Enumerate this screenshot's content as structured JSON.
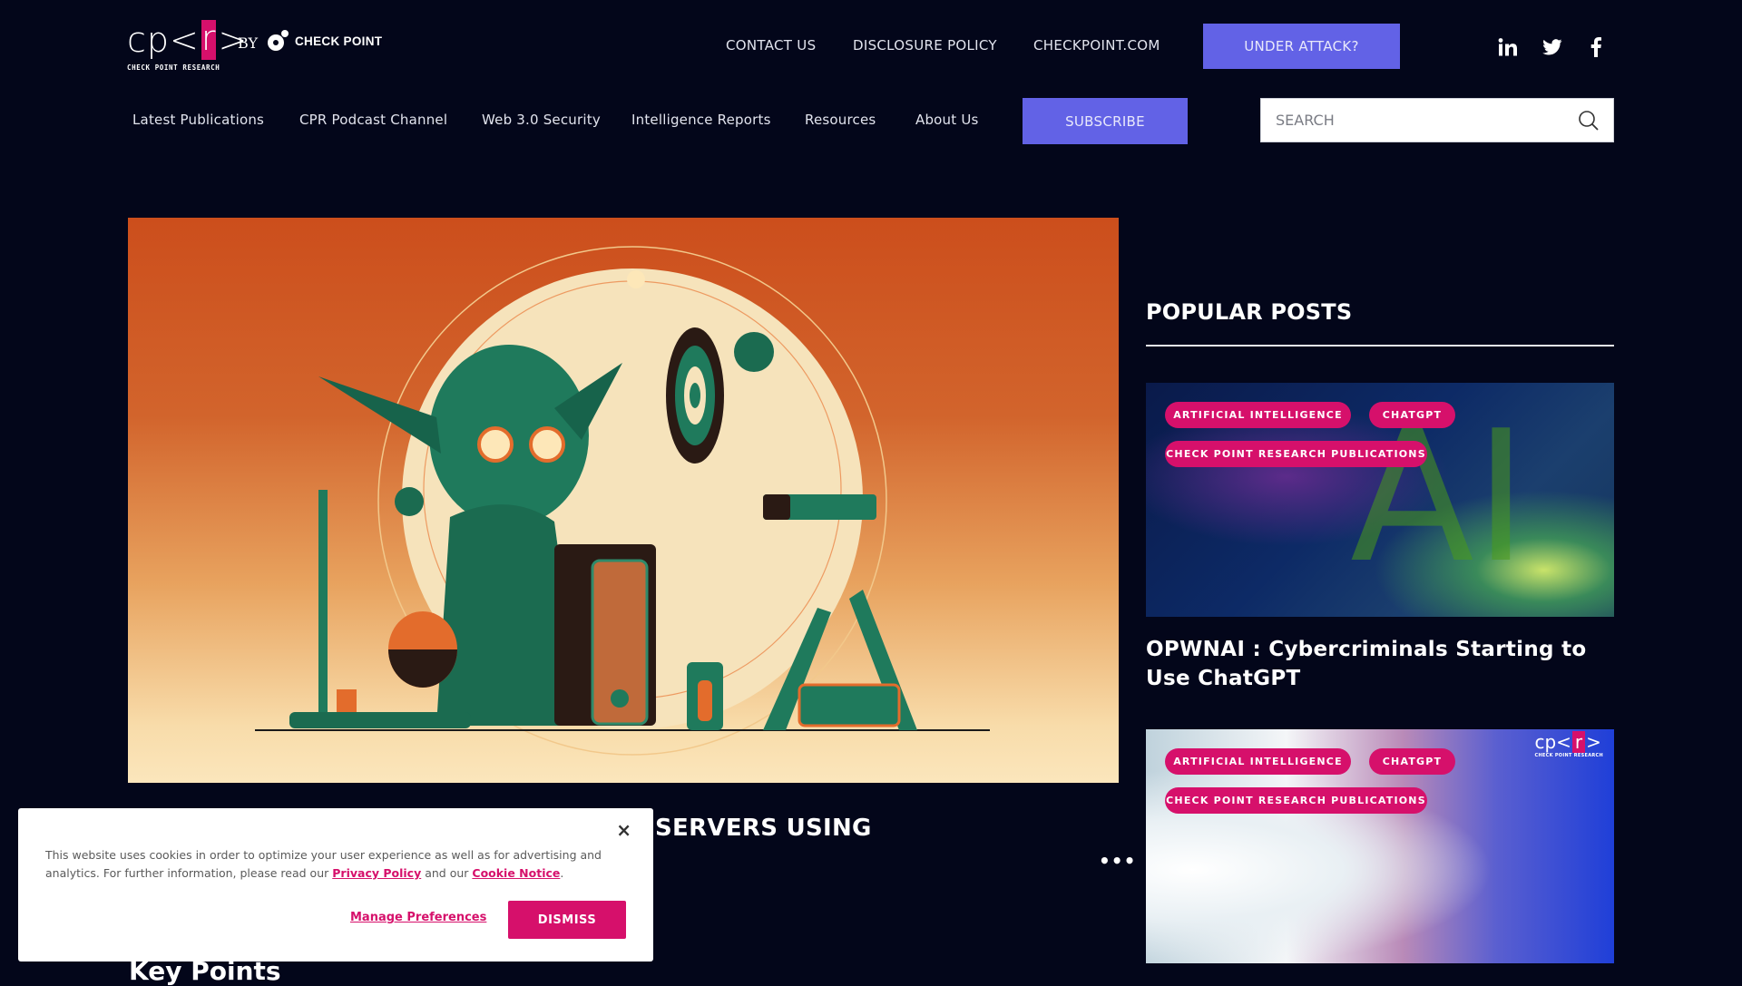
{
  "brand": {
    "logo_prefix": "cp<",
    "logo_r": "r",
    "logo_suffix": ">",
    "logo_subtitle": "CHECK POINT RESEARCH",
    "by_label": "BY",
    "partner_name": "CHECK POINT",
    "accent_color": "#d6106b",
    "button_color": "#6262e6"
  },
  "top_links": [
    "CONTACT US",
    "DISCLOSURE POLICY",
    "CHECKPOINT.COM"
  ],
  "under_attack_label": "UNDER ATTACK?",
  "social": [
    "linkedin-icon",
    "twitter-icon",
    "facebook-icon"
  ],
  "nav": {
    "items": [
      "Latest Publications",
      "CPR Podcast Channel",
      "Web 3.0 Security",
      "Intelligence Reports",
      "Resources",
      "About Us"
    ],
    "subscribe_label": "SUBSCRIBE",
    "search_placeholder": "SEARCH"
  },
  "article": {
    "headline_visible": "SERVERS USING",
    "more_label": "•••",
    "section_heading": "Key Points"
  },
  "sidebar": {
    "title": "POPULAR POSTS",
    "posts": [
      {
        "tags": [
          "ARTIFICIAL INTELLIGENCE",
          "CHATGPT",
          "CHECK POINT RESEARCH PUBLICATIONS"
        ],
        "title": "OPWNAI : Cybercriminals Starting to Use ChatGPT"
      },
      {
        "tags": [
          "ARTIFICIAL INTELLIGENCE",
          "CHATGPT",
          "CHECK POINT RESEARCH PUBLICATIONS"
        ],
        "image_badge_prefix": "cp<",
        "image_badge_r": "r",
        "image_badge_suffix": ">",
        "image_badge_sub": "CHECK POINT RESEARCH"
      }
    ]
  },
  "cookie": {
    "text_before": "This website uses cookies in order to optimize your user experience as well as for advertising and analytics.  For further information, please read our ",
    "privacy_link": "Privacy Policy",
    "text_middle": " and our ",
    "cookie_link": "Cookie Notice",
    "text_after": ".",
    "manage_label": "Manage Preferences",
    "dismiss_label": "DISMISS",
    "close_label": "×"
  }
}
